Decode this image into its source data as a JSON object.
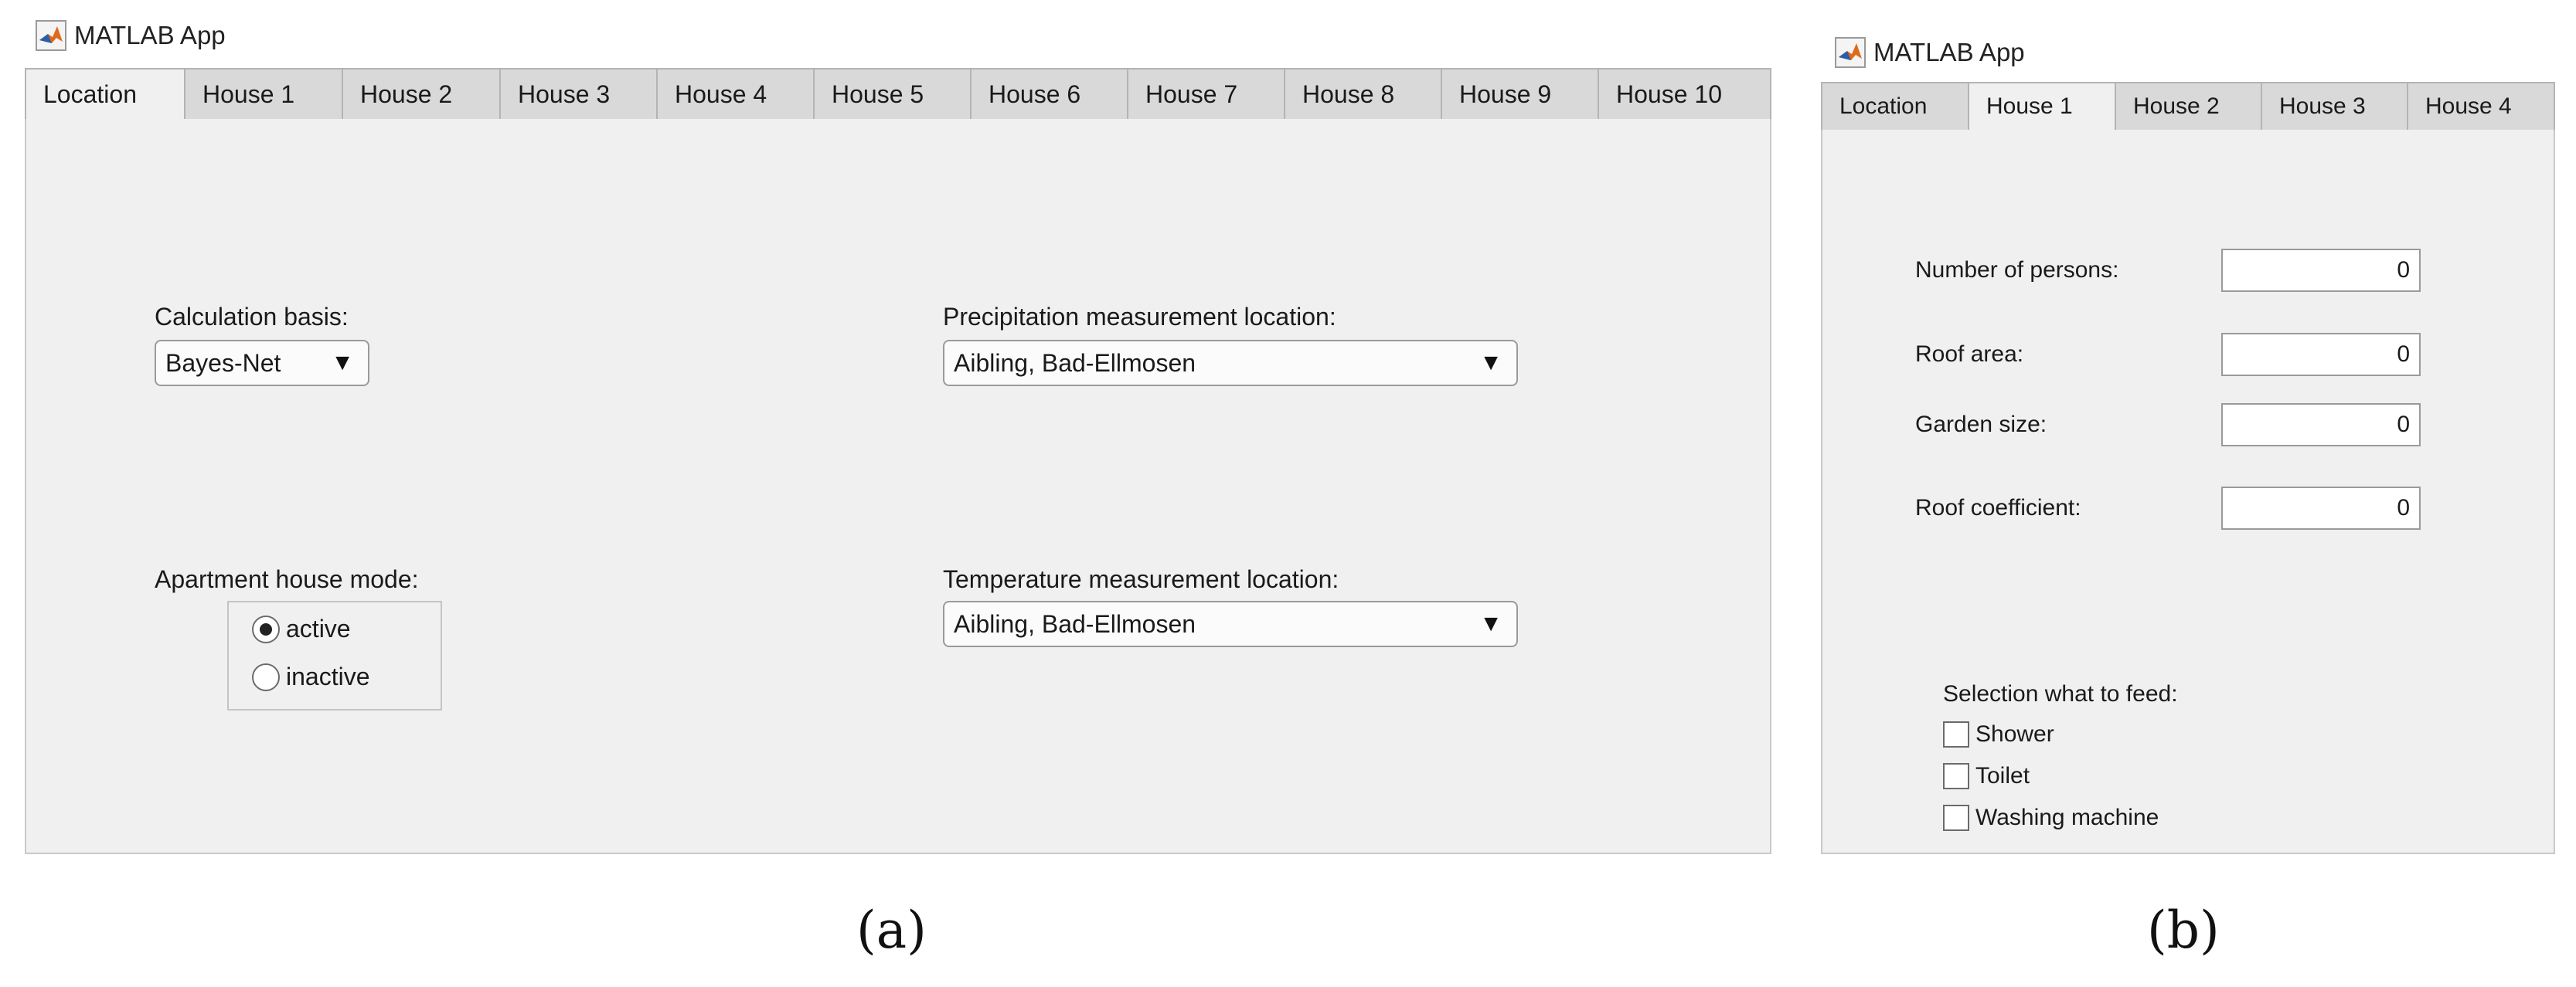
{
  "panel_a": {
    "window_title": "MATLAB App",
    "tabs": [
      "Location",
      "House 1",
      "House 2",
      "House 3",
      "House 4",
      "House 5",
      "House 6",
      "House 7",
      "House 8",
      "House 9",
      "House 10"
    ],
    "active_tab": "Location",
    "calculation_basis": {
      "label": "Calculation basis:",
      "value": "Bayes-Net"
    },
    "precipitation_location": {
      "label": "Precipitation measurement location:",
      "value": "Aibling, Bad-Ellmosen"
    },
    "apartment_house_mode": {
      "label": "Apartment house mode:",
      "options": [
        "active",
        "inactive"
      ],
      "selected": "active"
    },
    "temperature_location": {
      "label": "Temperature measurement location:",
      "value": "Aibling, Bad-Ellmosen"
    },
    "dropdown_arrow": "▼"
  },
  "panel_b": {
    "window_title": "MATLAB App",
    "tabs": [
      "Location",
      "House 1",
      "House 2",
      "House 3",
      "House 4"
    ],
    "active_tab": "House 1",
    "fields": [
      {
        "label": "Number of persons:",
        "value": "0"
      },
      {
        "label": "Roof area:",
        "value": "0"
      },
      {
        "label": "Garden size:",
        "value": "0"
      },
      {
        "label": "Roof coefficient:",
        "value": "0"
      }
    ],
    "feed_selection": {
      "label": "Selection what to feed:",
      "options": [
        "Shower",
        "Toilet",
        "Washing machine"
      ],
      "checked": [
        false,
        false,
        false
      ]
    }
  },
  "captions": {
    "a": "(a)",
    "b": "(b)"
  },
  "colors": {
    "panel_bg": "#f0f0f0",
    "tab_bg": "#d9d9d9",
    "logo_orange": "#e06a1b",
    "logo_blue": "#2a5fa8"
  },
  "icons": {
    "app_logo": "matlab-logo-icon",
    "dropdown": "dropdown-arrow-icon"
  }
}
